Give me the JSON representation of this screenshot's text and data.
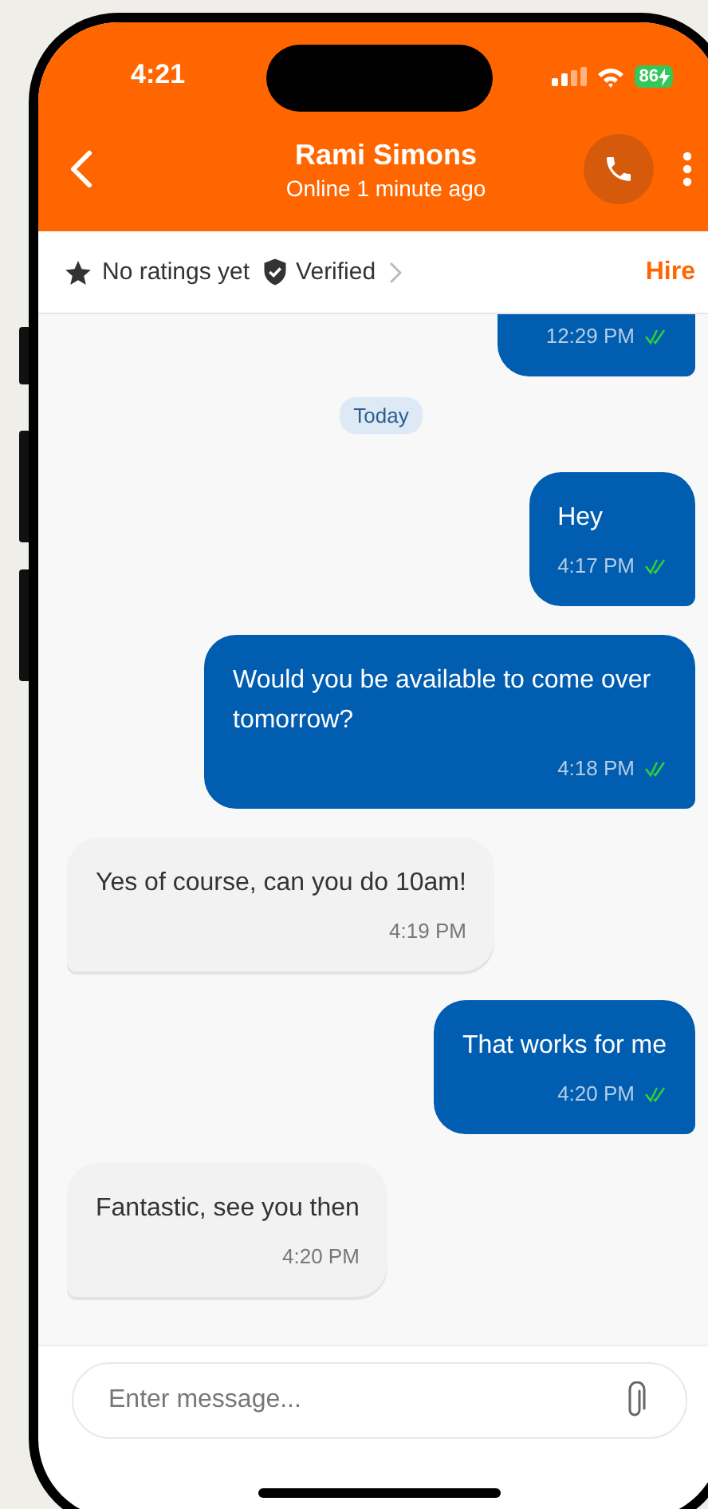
{
  "status_bar": {
    "time": "4:21",
    "battery": "86"
  },
  "header": {
    "name": "Rami Simons",
    "status": "Online 1 minute ago"
  },
  "info_bar": {
    "rating": "No ratings yet",
    "verified": "Verified",
    "action": "Hire"
  },
  "messages": [
    {
      "kind": "outgoing",
      "time": "12:29 PM",
      "read": true
    },
    {
      "kind": "date",
      "label": "Today"
    },
    {
      "kind": "outgoing",
      "text": "Hey",
      "time": "4:17 PM",
      "read": true
    },
    {
      "kind": "outgoing",
      "text": "Would you be available to come over tomorrow?",
      "time": "4:18 PM",
      "read": true
    },
    {
      "kind": "incoming",
      "text": "Yes of course, can you do 10am!",
      "time": "4:19 PM"
    },
    {
      "kind": "outgoing",
      "text": "That works for me",
      "time": "4:20 PM",
      "read": true
    },
    {
      "kind": "incoming",
      "text": "Fantastic, see you then",
      "time": "4:20 PM"
    }
  ],
  "composer": {
    "placeholder": "Enter message..."
  }
}
